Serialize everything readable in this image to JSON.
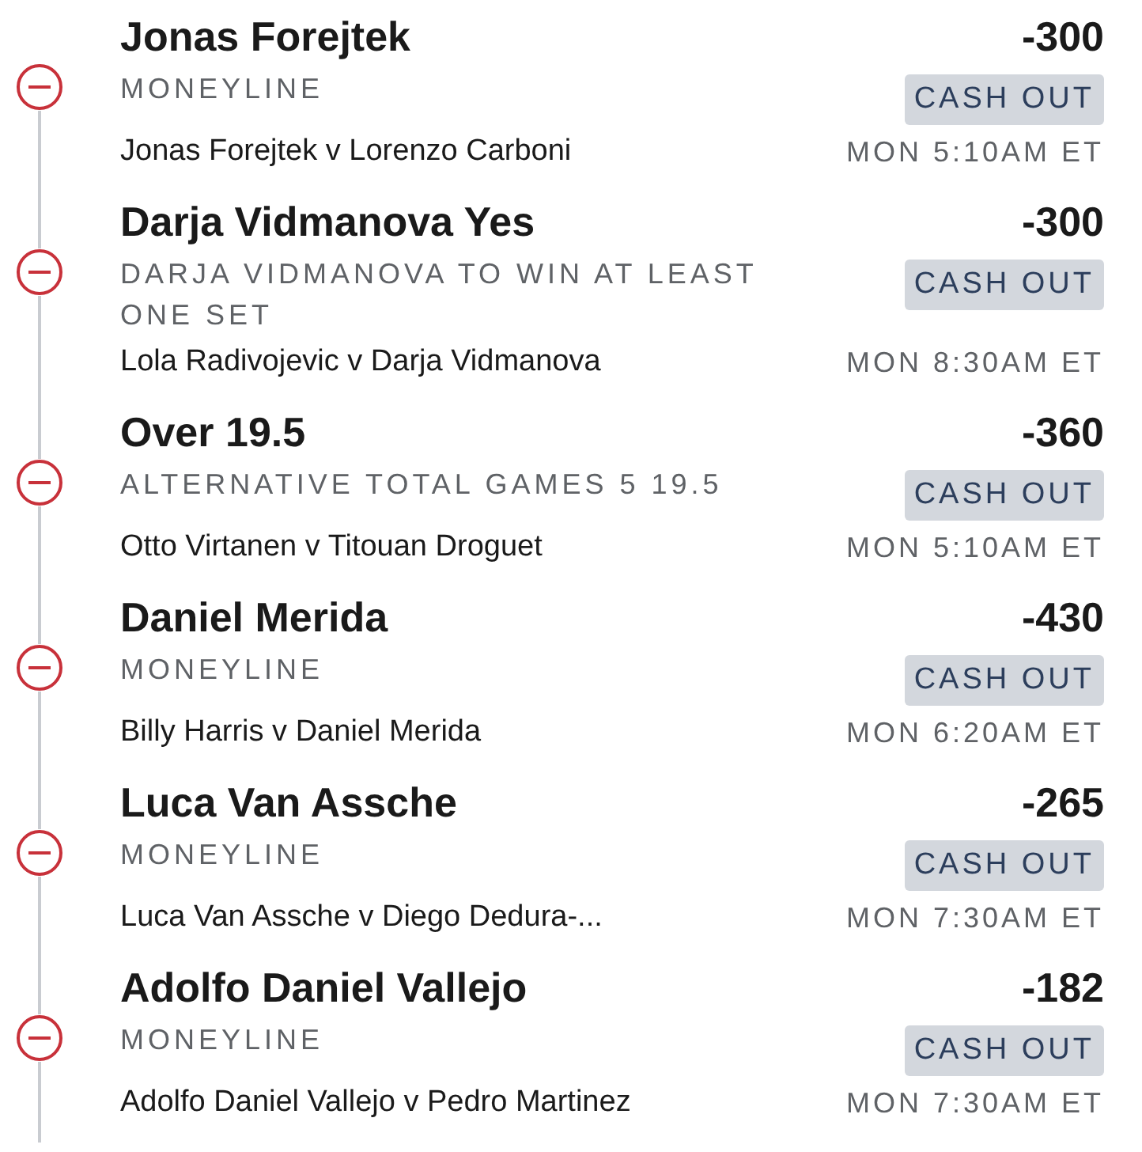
{
  "legs": [
    {
      "selection": "Jonas Forejtek",
      "odds": "-300",
      "market": "MONEYLINE",
      "cash_out": "CASH OUT",
      "matchup": "Jonas Forejtek v Lorenzo Carboni",
      "time": "MON 5:10AM ET"
    },
    {
      "selection": "Darja Vidmanova Yes",
      "odds": "-300",
      "market": "DARJA VIDMANOVA TO WIN AT LEAST ONE SET",
      "cash_out": "CASH OUT",
      "matchup": "Lola Radivojevic v Darja Vidmanova",
      "time": "MON 8:30AM ET"
    },
    {
      "selection": "Over 19.5",
      "odds": "-360",
      "market": "ALTERNATIVE TOTAL GAMES 5 19.5",
      "cash_out": "CASH OUT",
      "matchup": "Otto Virtanen v Titouan Droguet",
      "time": "MON 5:10AM ET"
    },
    {
      "selection": "Daniel Merida",
      "odds": "-430",
      "market": "MONEYLINE",
      "cash_out": "CASH OUT",
      "matchup": "Billy Harris v Daniel Merida",
      "time": "MON 6:20AM ET"
    },
    {
      "selection": "Luca Van Assche",
      "odds": "-265",
      "market": "MONEYLINE",
      "cash_out": "CASH OUT",
      "matchup": "Luca Van Assche v Diego Dedura-...",
      "time": "MON 7:30AM ET"
    },
    {
      "selection": "Adolfo Daniel Vallejo",
      "odds": "-182",
      "market": "MONEYLINE",
      "cash_out": "CASH OUT",
      "matchup": "Adolfo Daniel Vallejo v Pedro Martinez",
      "time": "MON 7:30AM ET"
    }
  ]
}
